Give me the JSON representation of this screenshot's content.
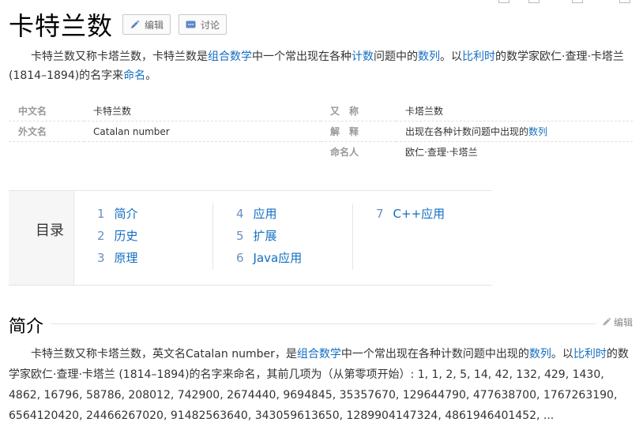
{
  "page": {
    "title": "卡特兰数",
    "buttons": {
      "edit": "编辑",
      "discuss": "讨论"
    },
    "intro": {
      "t1": "卡特兰数又称卡塔兰数，卡特兰数是",
      "l1": "组合数学",
      "t2": "中一个常出现在各种",
      "l2": "计数",
      "t3": "问题中的",
      "l3": "数列",
      "t4": "。以",
      "l4": "比利时",
      "t5": "的数学家欧仁·查理·卡塔兰(1814–1894)的名字来",
      "l5": "命名",
      "t6": "。"
    }
  },
  "info": {
    "rows": [
      {
        "k1": "中文名",
        "v1": "卡特兰数",
        "k2": "又　称",
        "v2": "卡塔兰数"
      },
      {
        "k1": "外文名",
        "v1": "Catalan number",
        "k2": "解　释",
        "v2_text": "出现在各种计数问题中出现的",
        "v2_link": "数列"
      },
      {
        "k2": "命名人",
        "v2": "欧仁·查理·卡塔兰"
      }
    ]
  },
  "toc": {
    "title": "目录",
    "items": [
      {
        "num": "1",
        "label": "简介"
      },
      {
        "num": "2",
        "label": "历史"
      },
      {
        "num": "3",
        "label": "原理"
      },
      {
        "num": "4",
        "label": "应用"
      },
      {
        "num": "5",
        "label": "扩展"
      },
      {
        "num": "6",
        "label": "Java应用"
      },
      {
        "num": "7",
        "label": "C++应用"
      }
    ]
  },
  "section": {
    "title": "简介",
    "edit": "编辑",
    "para": {
      "t1": "卡特兰数又称卡塔兰数，英文名Catalan number，是",
      "l1": "组合数学",
      "t2": "中一个常出现在各种计数问题中出现的",
      "l2": "数列",
      "t3": "。以",
      "l3": "比利时",
      "t4": "的数学家欧仁·查理·卡塔兰 (1814–1894)的名字来命名，其前几项为（从第零项开始）: 1, 1, 2, 5, 14, 42, 132, 429, 1430, 4862, 16796, 58786, 208012, 742900, 2674440, 9694845, 35357670, 129644790, 477638700, 1767263190, 6564120420, 24466267020, 91482563640, 343059613650, 1289904147324, 4861946401452, ..."
    }
  },
  "colors": {
    "link": "#136ec2",
    "toc_num": "#6b8fbf",
    "muted": "#999999"
  }
}
